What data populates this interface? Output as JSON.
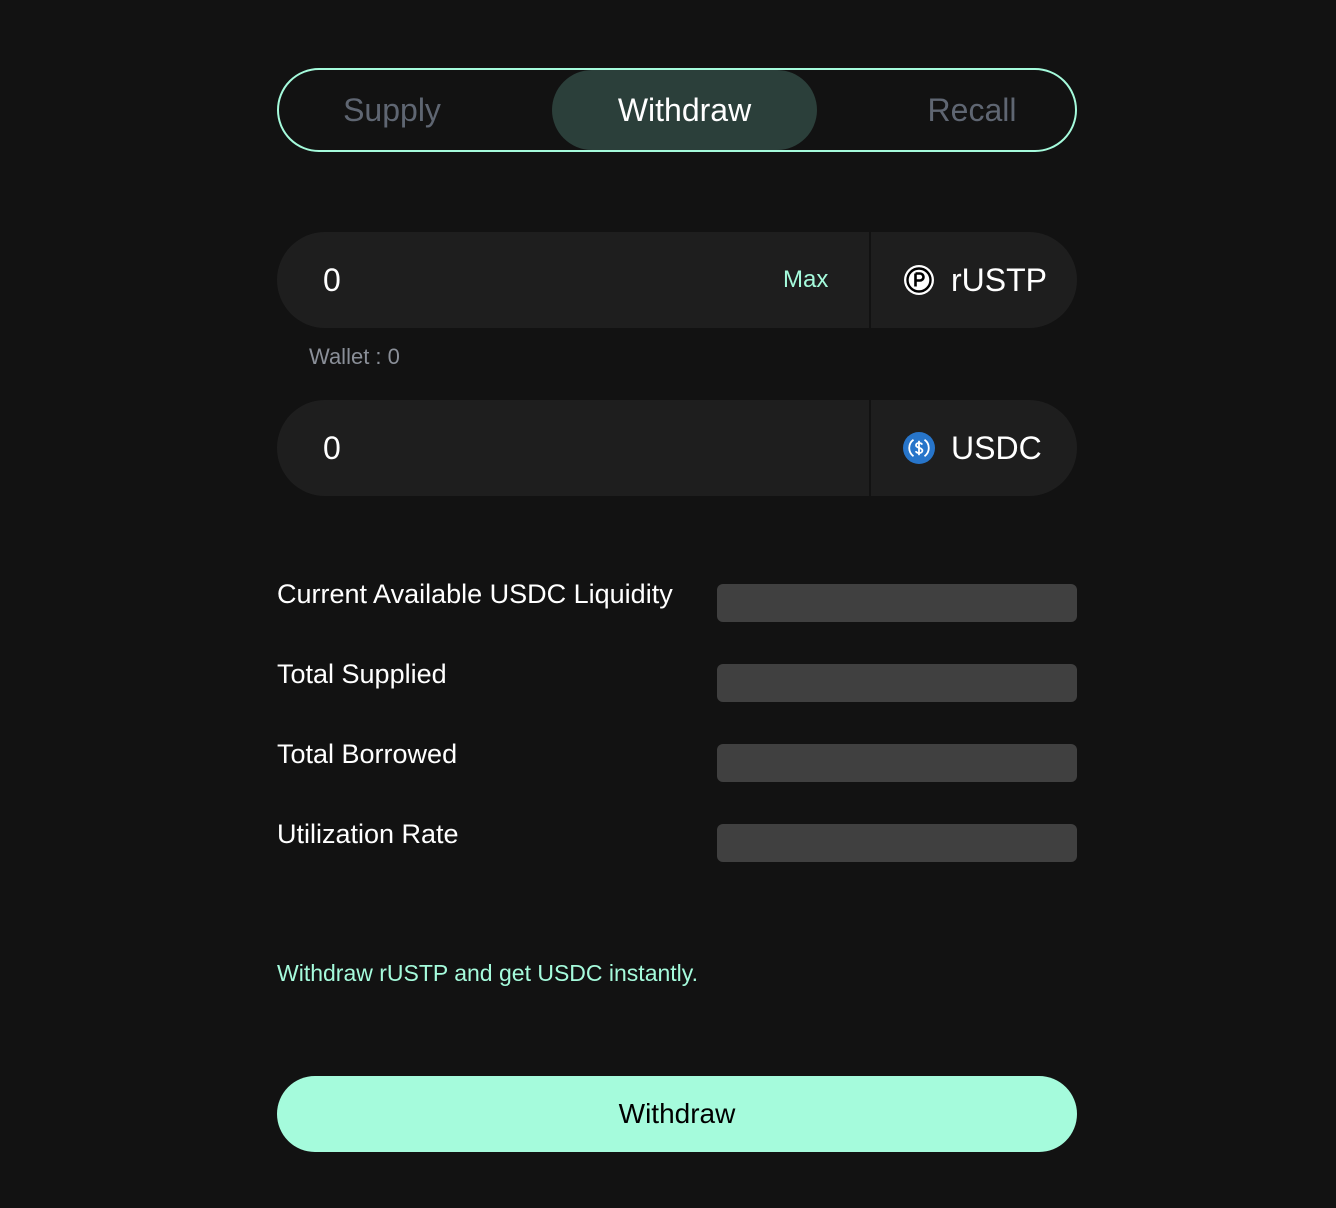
{
  "tabs": [
    {
      "label": "Supply",
      "active": false
    },
    {
      "label": "Withdraw",
      "active": true
    },
    {
      "label": "Recall",
      "active": false
    }
  ],
  "from_field": {
    "value": "0",
    "max_label": "Max",
    "token": "rUSTP",
    "token_icon": "rustp-icon"
  },
  "wallet": {
    "text": "Wallet : 0"
  },
  "to_field": {
    "value": "0",
    "token": "USDC",
    "token_icon": "usdc-icon"
  },
  "stats": [
    {
      "label": "Current Available USDC Liquidity"
    },
    {
      "label": "Total Supplied"
    },
    {
      "label": "Total Borrowed"
    },
    {
      "label": "Utilization Rate"
    }
  ],
  "info_text": "Withdraw rUSTP and get USDC instantly.",
  "action_button": "Withdraw",
  "colors": {
    "background": "#121212",
    "accent": "#a5fbdc",
    "active_tab": "#2b3f3a",
    "field": "#1e1e1e",
    "skeleton": "#404040",
    "usdc_blue": "#2775ca"
  }
}
